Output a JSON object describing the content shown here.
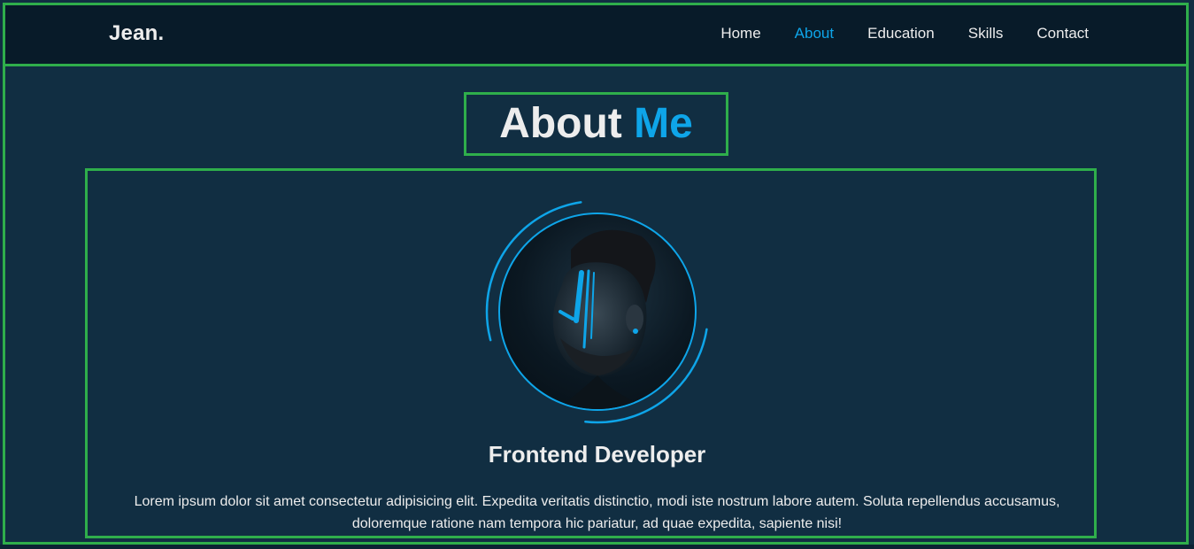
{
  "header": {
    "logo": "Jean.",
    "nav": [
      {
        "label": "Home",
        "active": false
      },
      {
        "label": "About",
        "active": true
      },
      {
        "label": "Education",
        "active": false
      },
      {
        "label": "Skills",
        "active": false
      },
      {
        "label": "Contact",
        "active": false
      }
    ]
  },
  "about": {
    "heading_main": "About",
    "heading_accent": "Me",
    "avatar_icon": "profile-photo",
    "role": "Frontend Developer",
    "description": "Lorem ipsum dolor sit amet consectetur adipisicing elit. Expedita veritatis distinctio, modi iste nostrum labore autem. Soluta repellendus accusamus, doloremque ratione nam tempora hic pariatur, ad quae expedita, sapiente nisi!"
  },
  "colors": {
    "background": "#112e42",
    "header_bg": "#081b29",
    "accent": "#0ea5e9",
    "text": "#ededed",
    "outline": "#2fae4b"
  }
}
